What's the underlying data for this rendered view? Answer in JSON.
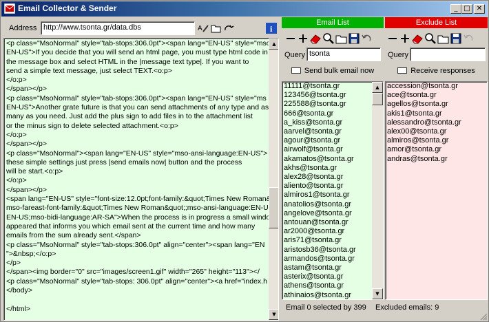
{
  "window": {
    "title": "Email Collector & Sender",
    "controls": {
      "minimize": "_",
      "maximize": "□",
      "close": "✕"
    }
  },
  "address": {
    "label": "Address",
    "value": "http://www.tsonta.gr/data.dbs"
  },
  "editor": {
    "lines": [
      "<p class=\"MsoNormal\" style=\"tab-stops:306.0pt\"><span lang=\"EN-US\" style=\"mso-",
      "EN-US\">If you decide that you will send an html page, you must type html code in",
      "the message box and select HTML in the |message text type|. If you want to",
      "send a simple text message, just select TEXT.<o:p>",
      "</o:p>",
      "</span></p>",
      "<p class=\"MsoNormal\" style=\"tab-stops:306.0pt\"><span lang=\"EN-US\" style=\"ms",
      "EN-US\">Another grate future is that you can send attachments of any type and as",
      "many as you need. Just add the plus sign to add files in to the attachment list",
      "or the minus sign to delete selected attachment.<o:p>",
      "</o:p>",
      "</span></p>",
      "<p class=\"MsoNormal\"><span lang=\"EN-US\" style=\"mso-ansi-language:EN-US\">",
      "these simple settings just press |send emails now| button and the process",
      "will be start.<o:p>",
      "</o:p>",
      "</span></p>",
      "<span lang=\"EN-US\" style=\"font-size:12.0pt;font-family:&quot;Times New Roman&",
      "mso-fareast-font-family:&quot;Times New Roman&quot;;mso-ansi-language:EN-US,",
      "EN-US;mso-bidi-language:AR-SA\">When the process is in progress a small windo",
      "appeared that informs you which email sent at the current time and how many",
      "emails from the sum already sent.</span>",
      "<p class=\"MsoNormal\" style=\"tab-stops:306.0pt\" align=\"center\"><span lang=\"EN",
      "\">&nbsp;</o:p>",
      "</p>",
      "</span><img border=\"0\" src=\"images/screen1.gif\" width=\"265\" height=\"113\"></",
      "<p class=\"MsoNormal\" style=\"tab-stops: 306.0pt\" align=\"center\"><a href=\"index.h",
      "</body>",
      "",
      "</html>"
    ]
  },
  "email_list": {
    "header": "Email List",
    "header_color": "#00b000",
    "query_label": "Query",
    "query_value": "tsonta",
    "action_label": "Send bulk email now",
    "items": [
      "11111@tsonta.gr",
      "123456@tsonta.gr",
      "225588@tsonta.gr",
      "666@tsonta.gr",
      "a_kiss@tsonta.gr",
      "aarvel@tsonta.gr",
      "agour@tsonta.gr",
      "airwolf@tsonta.gr",
      "akamatos@tsonta.gr",
      "akhs@tsonta.gr",
      "alex28@tsonta.gr",
      "aliento@tsonta.gr",
      "almiros1@tsonta.gr",
      "anatolios@tsonta.gr",
      "angelove@tsonta.gr",
      "antouan@tsonta.gr",
      "ar2000@tsonta.gr",
      "aris71@tsonta.gr",
      "aristosb36@tsonta.gr",
      "armandos@tsonta.gr",
      "astam@tsonta.gr",
      "asterix@tsonta.gr",
      "athens@tsonta.gr",
      "athinaios@tsonta.gr",
      "ava@tsonta.gr"
    ]
  },
  "exclude_list": {
    "header": "Exclude List",
    "header_color": "#e00000",
    "query_label": "Query",
    "query_value": "",
    "action_label": "Receive responses",
    "items": [
      "accession@tsonta.gr",
      "ace@tsonta.gr",
      "agellos@tsonta.gr",
      "akis1@tsonta.gr",
      "alessandro@tsonta.gr",
      "alex00@tsonta.gr",
      "almiros@tsonta.gr",
      "amor@tsonta.gr",
      "andras@tsonta.gr"
    ]
  },
  "status": {
    "selected": "Email 0 selected by 399",
    "excluded": "Excluded emails: 9"
  },
  "colors": {
    "list_green": "#e4ffe4",
    "list_pink": "#ffe6e6",
    "editor_bg": "#e4ffe4"
  }
}
